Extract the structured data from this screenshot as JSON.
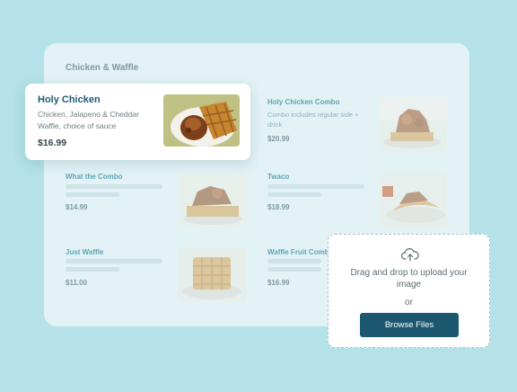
{
  "menu": {
    "section_title": "Chicken & Waffle",
    "featured": {
      "title": "Holy Chicken",
      "description": "Chicken, Jalapeno & Cheddar Waffle, choice of sauce",
      "price": "$16.99",
      "image": "chicken-waffle-photo"
    },
    "items": [
      {
        "title": "Holy Chicken Combo",
        "description": "Combo includes regular side + drink",
        "price": "$20.99",
        "image": "chicken-waffle-stack-photo"
      },
      {
        "title": "What the Combo",
        "description": "",
        "price": "$14.99",
        "image": "chicken-waffle-photo"
      },
      {
        "title": "Twaco",
        "description": "",
        "price": "$18.99",
        "image": "twaco-photo"
      },
      {
        "title": "Just Waffle",
        "description": "",
        "price": "$11.00",
        "image": "plain-waffle-photo"
      },
      {
        "title": "Waffle Fruit Combo",
        "description": "",
        "price": "$16.99",
        "image": ""
      }
    ]
  },
  "upload": {
    "icon": "cloud-upload-icon",
    "instruction": "Drag and drop to upload your image",
    "or_label": "or",
    "button_label": "Browse Files"
  },
  "colors": {
    "background": "#b4e2e8",
    "panel": "#e2f2f5",
    "accent": "#1c5770",
    "item_title": "#5ea5b6"
  }
}
